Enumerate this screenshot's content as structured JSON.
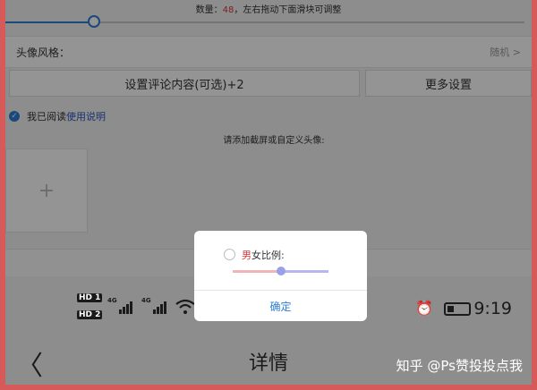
{
  "quantity": {
    "prefix": "数量：",
    "value": "48",
    "suffix": "，左右拖动下面滑块可调整",
    "slider_fraction": 0.17
  },
  "avatar_style": {
    "label": "头像风格：",
    "value": "随机",
    "chevron": ">"
  },
  "buttons": {
    "comment": "设置评论内容(可选)+2",
    "more": "更多设置"
  },
  "agreement": {
    "text": "我已阅读",
    "link": "使用说明",
    "check_icon": "✓"
  },
  "hint": "请添加截屏或自定义头像:",
  "add_tile": {
    "plus": "+"
  },
  "status_bar": {
    "hd1": "HD 1",
    "hd2": "HD 2",
    "net1": "4G",
    "net2": "4G",
    "wifi_icon": "wifi-icon",
    "alarm_icon": "⏰",
    "battery_level": 0.3,
    "time": "9:19"
  },
  "nav": {
    "back": "〈",
    "title": "详情",
    "more": "•••"
  },
  "watermark": "知乎 @Ps赞投投点我",
  "dialog": {
    "label_male": "男",
    "label_rest": "女比例:",
    "ratio_fraction": 0.5,
    "confirm": "确定"
  },
  "colors": {
    "accent": "#2c7fd6",
    "frame": "#d65a5a",
    "male": "#d23b3b"
  }
}
